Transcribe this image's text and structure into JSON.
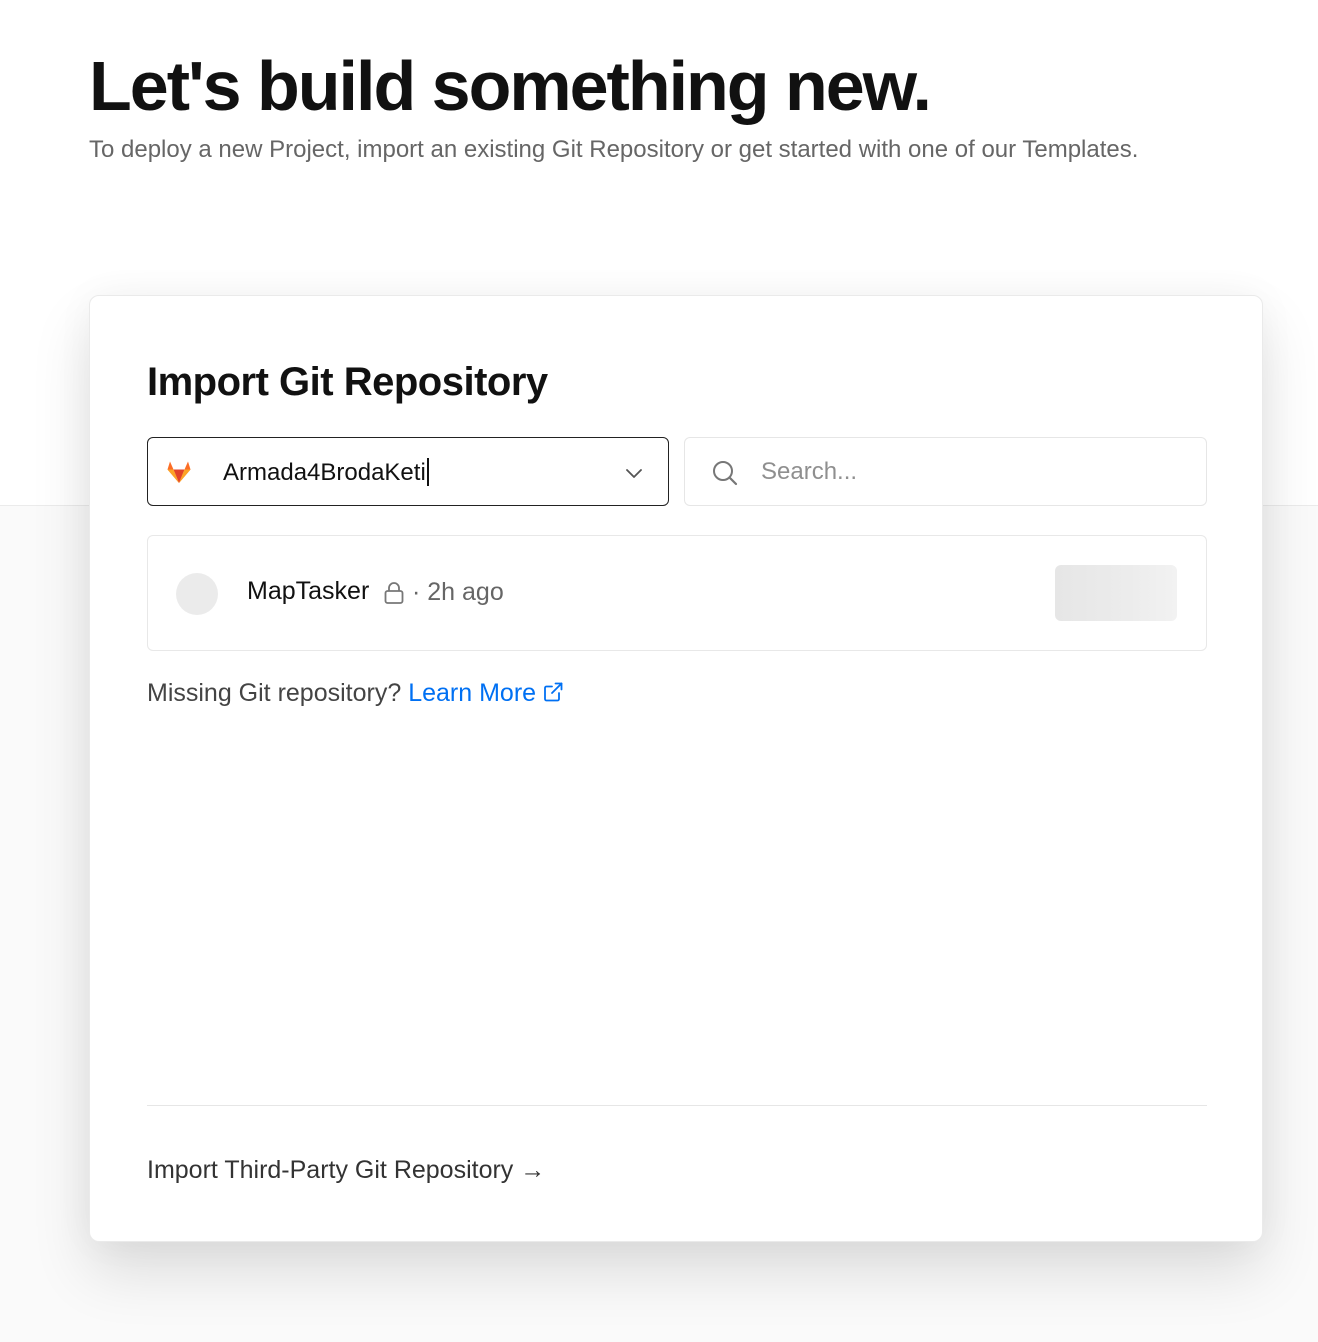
{
  "hero": {
    "title": "Let's build something new.",
    "subtitle": "To deploy a new Project, import an existing Git Repository or get started with one of our Templates."
  },
  "import_card": {
    "title": "Import Git Repository",
    "account_selector": {
      "provider_icon": "gitlab-icon",
      "selected_value": "Armada4BrodaKeti"
    },
    "search": {
      "placeholder": "Search..."
    },
    "repositories": [
      {
        "name": "MapTasker",
        "visibility_icon": "lock-icon",
        "updated": "· 2h ago"
      }
    ],
    "missing": {
      "text": "Missing Git repository?",
      "link_label": "Learn More"
    },
    "third_party_label": "Import Third-Party Git Repository →"
  },
  "colors": {
    "accent_link": "#0070f3",
    "gitlab_orange": "#FC6D26",
    "gitlab_red": "#E24329",
    "gitlab_amber": "#FCA326"
  }
}
